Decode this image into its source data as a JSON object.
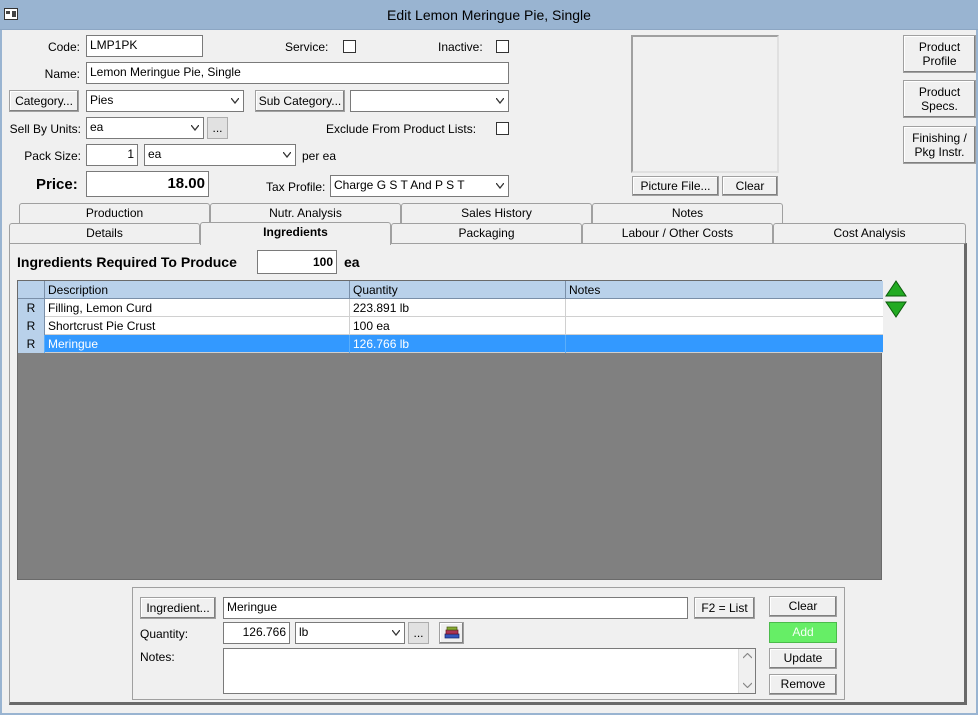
{
  "window": {
    "title": "Edit Lemon Meringue Pie, Single"
  },
  "form": {
    "code_label": "Code:",
    "code_value": "LMP1PK",
    "service_label": "Service:",
    "inactive_label": "Inactive:",
    "name_label": "Name:",
    "name_value": "Lemon Meringue Pie, Single",
    "category_button": "Category...",
    "category_value": "Pies",
    "subcategory_button": "Sub Category...",
    "subcategory_value": "",
    "sellby_label": "Sell By Units:",
    "sellby_value": "ea",
    "sellby_more": "...",
    "exclude_label": "Exclude From Product Lists:",
    "packsize_label": "Pack Size:",
    "packsize_value": "1",
    "packsize_unit": "ea",
    "packsize_per": "per ea",
    "price_label": "Price:",
    "price_value": "18.00",
    "tax_label": "Tax Profile:",
    "tax_value": "Charge G S T And P S T"
  },
  "picture": {
    "file_button": "Picture File...",
    "clear_button": "Clear"
  },
  "side_buttons": {
    "profile": "Product Profile",
    "specs": "Product Specs.",
    "finishing": "Finishing / Pkg Instr."
  },
  "tabs": {
    "row1": [
      "Production",
      "Nutr. Analysis",
      "Sales History",
      "Notes"
    ],
    "row2": [
      "Details",
      "Ingredients",
      "Packaging",
      "Labour / Other Costs",
      "Cost Analysis"
    ]
  },
  "ingredients": {
    "produce_label": "Ingredients Required To Produce",
    "produce_qty": "100",
    "produce_unit": "ea",
    "columns": [
      "Description",
      "Quantity",
      "Notes"
    ],
    "rows": [
      {
        "mark": "R",
        "description": "Filling, Lemon Curd",
        "quantity": "223.891 lb",
        "notes": ""
      },
      {
        "mark": "R",
        "description": "Shortcrust Pie Crust",
        "quantity": "100 ea",
        "notes": ""
      },
      {
        "mark": "R",
        "description": "Meringue",
        "quantity": "126.766 lb",
        "notes": ""
      }
    ]
  },
  "editor": {
    "ingredient_button": "Ingredient...",
    "ingredient_value": "Meringue",
    "f2_button": "F2 = List",
    "quantity_label": "Quantity:",
    "quantity_value": "126.766",
    "quantity_unit": "lb",
    "more": "...",
    "notes_label": "Notes:",
    "notes_value": "",
    "clear_button": "Clear",
    "add_button": "Add",
    "update_button": "Update",
    "remove_button": "Remove"
  },
  "colors": {
    "titlebar": "#99b4d1",
    "selection": "#3399ff",
    "grid_header": "#b9d1ea",
    "add_button": "#66ee66",
    "arrows": "#22aa22"
  }
}
